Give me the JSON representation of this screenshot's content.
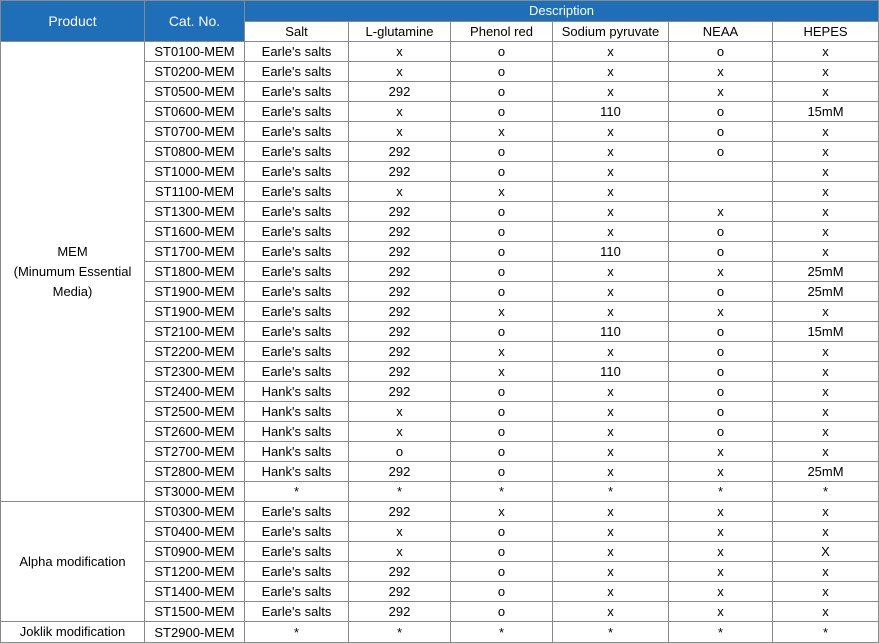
{
  "headers": {
    "product": "Product",
    "cat_no": "Cat. No.",
    "description": "Description",
    "columns": [
      "Salt",
      "L-glutamine",
      "Phenol red",
      "Sodium pyruvate",
      "NEAA",
      "HEPES"
    ]
  },
  "groups": [
    {
      "product": "MEM\n(Minumum Essential\nMedia)",
      "rows": [
        {
          "cat": "ST0100-MEM",
          "cells": [
            "Earle's salts",
            "x",
            "o",
            "x",
            "o",
            "x"
          ]
        },
        {
          "cat": "ST0200-MEM",
          "cells": [
            "Earle's salts",
            "x",
            "o",
            "x",
            "x",
            "x"
          ]
        },
        {
          "cat": "ST0500-MEM",
          "cells": [
            "Earle's salts",
            "292",
            "o",
            "x",
            "x",
            "x"
          ]
        },
        {
          "cat": "ST0600-MEM",
          "cells": [
            "Earle's salts",
            "x",
            "o",
            "110",
            "o",
            "15mM"
          ]
        },
        {
          "cat": "ST0700-MEM",
          "cells": [
            "Earle's salts",
            "x",
            "x",
            "x",
            "o",
            "x"
          ]
        },
        {
          "cat": "ST0800-MEM",
          "cells": [
            "Earle's salts",
            "292",
            "o",
            "x",
            "o",
            "x"
          ]
        },
        {
          "cat": "ST1000-MEM",
          "cells": [
            "Earle's salts",
            "292",
            "o",
            "x",
            "",
            "x"
          ]
        },
        {
          "cat": "ST1100-MEM",
          "cells": [
            "Earle's salts",
            "x",
            "x",
            "x",
            "",
            "x"
          ]
        },
        {
          "cat": "ST1300-MEM",
          "cells": [
            "Earle's salts",
            "292",
            "o",
            "x",
            "x",
            "x"
          ]
        },
        {
          "cat": "ST1600-MEM",
          "cells": [
            "Earle's salts",
            "292",
            "o",
            "x",
            "o",
            "x"
          ]
        },
        {
          "cat": "ST1700-MEM",
          "cells": [
            "Earle's salts",
            "292",
            "o",
            "110",
            "o",
            "x"
          ]
        },
        {
          "cat": "ST1800-MEM",
          "cells": [
            "Earle's salts",
            "292",
            "o",
            "x",
            "x",
            "25mM"
          ]
        },
        {
          "cat": "ST1900-MEM",
          "cells": [
            "Earle's salts",
            "292",
            "o",
            "x",
            "o",
            "25mM"
          ]
        },
        {
          "cat": "ST1900-MEM",
          "cells": [
            "Earle's salts",
            "292",
            "x",
            "x",
            "x",
            "x"
          ]
        },
        {
          "cat": "ST2100-MEM",
          "cells": [
            "Earle's salts",
            "292",
            "o",
            "110",
            "o",
            "15mM"
          ]
        },
        {
          "cat": "ST2200-MEM",
          "cells": [
            "Earle's salts",
            "292",
            "x",
            "x",
            "o",
            "x"
          ]
        },
        {
          "cat": "ST2300-MEM",
          "cells": [
            "Earle's salts",
            "292",
            "x",
            "110",
            "o",
            "x"
          ]
        },
        {
          "cat": "ST2400-MEM",
          "cells": [
            "Hank's salts",
            "292",
            "o",
            "x",
            "o",
            "x"
          ]
        },
        {
          "cat": "ST2500-MEM",
          "cells": [
            "Hank's salts",
            "x",
            "o",
            "x",
            "o",
            "x"
          ]
        },
        {
          "cat": "ST2600-MEM",
          "cells": [
            "Hank's salts",
            "x",
            "o",
            "x",
            "o",
            "x"
          ]
        },
        {
          "cat": "ST2700-MEM",
          "cells": [
            "Hank's salts",
            "o",
            "o",
            "x",
            "x",
            "x"
          ]
        },
        {
          "cat": "ST2800-MEM",
          "cells": [
            "Hank's salts",
            "292",
            "o",
            "x",
            "x",
            "25mM"
          ]
        },
        {
          "cat": "ST3000-MEM",
          "cells": [
            "*",
            "*",
            "*",
            "*",
            "*",
            "*"
          ]
        }
      ]
    },
    {
      "product": "Alpha modification",
      "rows": [
        {
          "cat": "ST0300-MEM",
          "cells": [
            "Earle's salts",
            "292",
            "x",
            "x",
            "x",
            "x"
          ]
        },
        {
          "cat": "ST0400-MEM",
          "cells": [
            "Earle's salts",
            "x",
            "o",
            "x",
            "x",
            "x"
          ]
        },
        {
          "cat": "ST0900-MEM",
          "cells": [
            "Earle's salts",
            "x",
            "o",
            "x",
            "x",
            "X"
          ]
        },
        {
          "cat": "ST1200-MEM",
          "cells": [
            "Earle's salts",
            "292",
            "o",
            "x",
            "x",
            "x"
          ]
        },
        {
          "cat": "ST1400-MEM",
          "cells": [
            "Earle's salts",
            "292",
            "o",
            "x",
            "x",
            "x"
          ]
        },
        {
          "cat": "ST1500-MEM",
          "cells": [
            "Earle's salts",
            "292",
            "o",
            "x",
            "x",
            "x"
          ]
        }
      ]
    },
    {
      "product": "Joklik modification",
      "rows": [
        {
          "cat": "ST2900-MEM",
          "cells": [
            "*",
            "*",
            "*",
            "*",
            "*",
            "*"
          ]
        }
      ]
    }
  ]
}
